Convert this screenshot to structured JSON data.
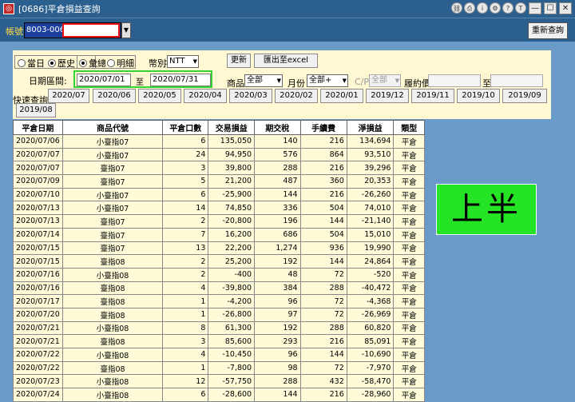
{
  "window": {
    "title": "[0686]平倉損益查詢"
  },
  "account": {
    "label": "帳號",
    "value": "8003-0066-",
    "requery_label": "重新查詢"
  },
  "filters": {
    "radio_current": "當日",
    "radio_history": "歷史",
    "radio_summary": "彙總",
    "radio_detail": "明細",
    "currency_label": "幣別",
    "currency_value": "NTT",
    "update_label": "更新",
    "export_label": "匯出至excel",
    "date_range_label": "日期區間:",
    "date_from": "2020/07/01",
    "to_label": "至",
    "date_to": "2020/07/31",
    "product_label": "商品",
    "product_value": "全部",
    "month_label": "月份",
    "month_value": "全部+",
    "cp_label": "C/P",
    "cp_value": "全部",
    "strike_label": "履約價",
    "strike_to_label": "至"
  },
  "quick": {
    "label": "快速查詢:",
    "months": [
      "2020/07",
      "2020/06",
      "2020/05",
      "2020/04",
      "2020/03",
      "2020/02",
      "2020/01",
      "2019/12",
      "2019/11",
      "2019/10",
      "2019/09",
      "2019/08"
    ]
  },
  "table": {
    "headers": [
      "平倉日期",
      "商品代號",
      "平倉口數",
      "交易損益",
      "期交稅",
      "手續費",
      "淨損益",
      "類型"
    ],
    "rows": [
      [
        "2020/07/06",
        "小臺指07",
        "6",
        "135,050",
        "140",
        "216",
        "134,694",
        "平倉"
      ],
      [
        "2020/07/07",
        "小臺指07",
        "24",
        "94,950",
        "576",
        "864",
        "93,510",
        "平倉"
      ],
      [
        "2020/07/07",
        "臺指07",
        "3",
        "39,800",
        "288",
        "216",
        "39,296",
        "平倉"
      ],
      [
        "2020/07/09",
        "臺指07",
        "5",
        "21,200",
        "487",
        "360",
        "20,353",
        "平倉"
      ],
      [
        "2020/07/10",
        "小臺指07",
        "6",
        "-25,900",
        "144",
        "216",
        "-26,260",
        "平倉"
      ],
      [
        "2020/07/13",
        "小臺指07",
        "14",
        "74,850",
        "336",
        "504",
        "74,010",
        "平倉"
      ],
      [
        "2020/07/13",
        "臺指07",
        "2",
        "-20,800",
        "196",
        "144",
        "-21,140",
        "平倉"
      ],
      [
        "2020/07/14",
        "臺指07",
        "7",
        "16,200",
        "686",
        "504",
        "15,010",
        "平倉"
      ],
      [
        "2020/07/15",
        "臺指07",
        "13",
        "22,200",
        "1,274",
        "936",
        "19,990",
        "平倉"
      ],
      [
        "2020/07/15",
        "臺指08",
        "2",
        "25,200",
        "192",
        "144",
        "24,864",
        "平倉"
      ],
      [
        "2020/07/16",
        "小臺指08",
        "2",
        "-400",
        "48",
        "72",
        "-520",
        "平倉"
      ],
      [
        "2020/07/16",
        "臺指08",
        "4",
        "-39,800",
        "384",
        "288",
        "-40,472",
        "平倉"
      ],
      [
        "2020/07/17",
        "臺指08",
        "1",
        "-4,200",
        "96",
        "72",
        "-4,368",
        "平倉"
      ],
      [
        "2020/07/20",
        "臺指08",
        "1",
        "-26,800",
        "97",
        "72",
        "-26,969",
        "平倉"
      ],
      [
        "2020/07/21",
        "小臺指08",
        "8",
        "61,300",
        "192",
        "288",
        "60,820",
        "平倉"
      ],
      [
        "2020/07/21",
        "臺指08",
        "3",
        "85,600",
        "293",
        "216",
        "85,091",
        "平倉"
      ],
      [
        "2020/07/22",
        "小臺指08",
        "4",
        "-10,450",
        "96",
        "144",
        "-10,690",
        "平倉"
      ],
      [
        "2020/07/22",
        "臺指08",
        "1",
        "-7,800",
        "98",
        "72",
        "-7,970",
        "平倉"
      ],
      [
        "2020/07/23",
        "小臺指08",
        "12",
        "-57,750",
        "288",
        "432",
        "-58,470",
        "平倉"
      ],
      [
        "2020/07/24",
        "小臺指08",
        "6",
        "-28,600",
        "144",
        "216",
        "-28,960",
        "平倉"
      ]
    ]
  },
  "badge": {
    "text": "上半"
  }
}
